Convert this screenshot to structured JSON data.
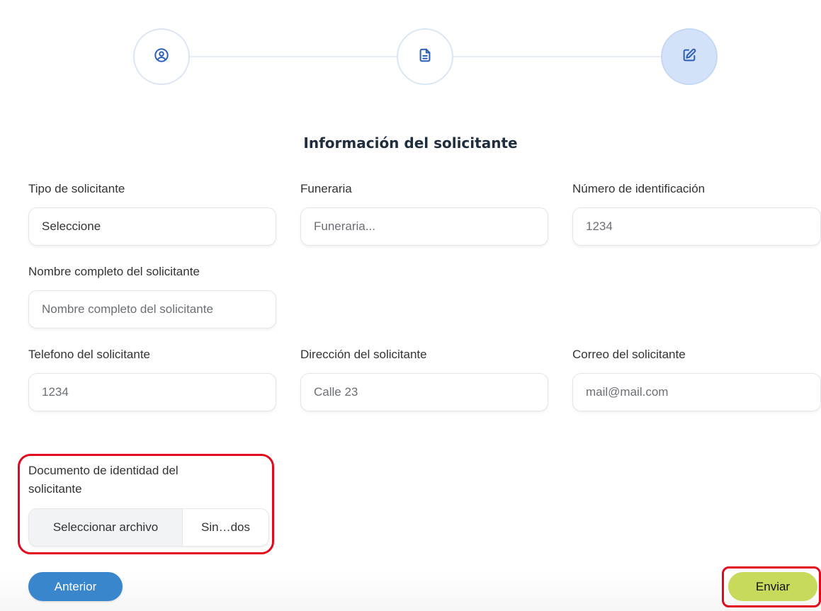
{
  "stepper": {
    "steps": [
      {
        "icon": "user-circle-icon",
        "state": "completed"
      },
      {
        "icon": "document-icon",
        "state": "completed"
      },
      {
        "icon": "edit-icon",
        "state": "active"
      }
    ],
    "colors": {
      "active_bg": "#d3e2f8",
      "icon": "#2d5fb5"
    }
  },
  "form": {
    "title": "Información del solicitante",
    "tipo_solicitante": {
      "label": "Tipo de solicitante",
      "value": "Seleccione"
    },
    "funeraria": {
      "label": "Funeraria",
      "placeholder": "Funeraria..."
    },
    "numero_identificacion": {
      "label": "Número de identificación",
      "placeholder": "1234"
    },
    "nombre_completo": {
      "label": "Nombre completo del solicitante",
      "placeholder": "Nombre completo del solicitante"
    },
    "telefono": {
      "label": "Telefono del solicitante",
      "placeholder": "1234"
    },
    "direccion": {
      "label": "Dirección del solicitante",
      "placeholder": "Calle 23"
    },
    "correo": {
      "label": "Correo del solicitante",
      "placeholder": "mail@mail.com"
    },
    "documento": {
      "label_line1": "Documento de identidad del",
      "label_line2": "solicitante",
      "button_label": "Seleccionar archivo",
      "file_status": "Sin…dos"
    }
  },
  "actions": {
    "previous_label": "Anterior",
    "submit_label": "Enviar",
    "colors": {
      "previous": "#3a86cc",
      "submit": "#c9d95c",
      "highlight": "#e0091d"
    }
  }
}
